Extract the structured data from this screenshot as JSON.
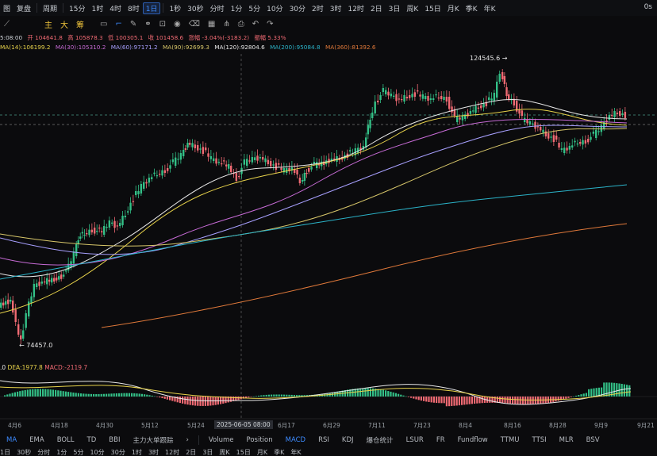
{
  "toolbar": {
    "items": [
      "图",
      "复盘",
      "周期",
      "15分",
      "1时",
      "4时",
      "8时",
      "1日",
      "1秒",
      "30秒",
      "分时",
      "1分",
      "5分",
      "10分",
      "30分",
      "2时",
      "3时",
      "12时",
      "2日",
      "3日",
      "周K",
      "15日",
      "月K",
      "季K",
      "年K"
    ],
    "active": "1日",
    "right": "0s"
  },
  "drawbar": {
    "chars": [
      "主",
      "大",
      "筹"
    ]
  },
  "info": {
    "time": "5:08:00",
    "open": "开 104641.8",
    "high": "高 105878.3",
    "low": "低 100305.1",
    "close": "收 101458.6",
    "change": "涨幅 -3.04%(-3183.2)",
    "amp": "振幅 5.33%"
  },
  "ma": {
    "ma14": "MA(14):106199.2",
    "ma30": "MA(30):105310.2",
    "ma60": "MA(60):97171.2",
    "ma90": "MA(90):92699.3",
    "ma120": "MA(120):92804.6",
    "ma200": "MA(200):95084.8",
    "ma360": "MA(360):81392.6"
  },
  "labels": {
    "high": "124545.6",
    "low": "74457.0"
  },
  "macd": {
    "dif": ".0",
    "dea": "DEA:1977.8",
    "macd": "MACD:-2119.7"
  },
  "xaxis": {
    "ticks": [
      "4月6",
      "4月18",
      "4月30",
      "5月12",
      "5月24",
      "6月17",
      "6月29",
      "7月11",
      "7月23",
      "8月4",
      "8月16",
      "8月28",
      "9月9",
      "9月21"
    ],
    "highlight": "2025-06-05 08:00"
  },
  "indicators": {
    "main": [
      "MA",
      "EMA",
      "BOLL",
      "TD",
      "BBI",
      "主力大单跟踪"
    ],
    "sub": [
      "Volume",
      "Position",
      "MACD",
      "RSI",
      "KDJ",
      "爆仓统计",
      "LSUR",
      "FR",
      "Fundflow",
      "TTMU",
      "TTSI",
      "MLR",
      "BSV"
    ],
    "active": [
      "MA",
      "MACD"
    ]
  },
  "bottom": {
    "items": [
      "1日",
      "30秒",
      "分时",
      "1分",
      "5分",
      "10分",
      "30分",
      "1时",
      "3时",
      "12时",
      "2日",
      "3日",
      "周K",
      "15日",
      "月K",
      "季K",
      "年K"
    ]
  },
  "colors": {
    "up": "#33c087",
    "down": "#f06a73",
    "ma14": "#e8e8e8",
    "ma30": "#e8d34b",
    "ma60": "#c76bd6",
    "ma90": "#a8a0ff",
    "ma120": "#d8c76a",
    "ma200": "#2bb3c8",
    "ma360": "#e0793a"
  },
  "chart_data": {
    "type": "candlestick",
    "y_high_label": 124545.6,
    "y_low_label": 74457.0
  }
}
